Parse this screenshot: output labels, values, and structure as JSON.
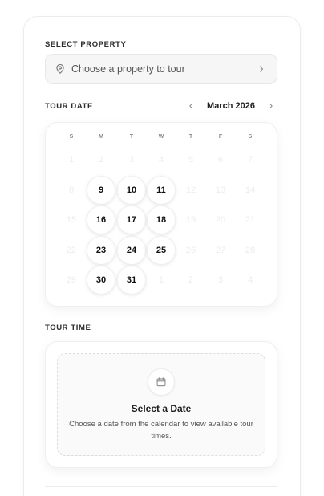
{
  "property": {
    "label": "SELECT PROPERTY",
    "placeholder": "Choose a property to tour",
    "icons": [
      "map-pin-icon",
      "chevron-right-icon"
    ]
  },
  "tour_date": {
    "label": "TOUR DATE",
    "month": "March 2026",
    "weekdays": [
      "S",
      "M",
      "T",
      "W",
      "T",
      "F",
      "S"
    ],
    "weeks": [
      [
        {
          "d": "1",
          "on": false
        },
        {
          "d": "2",
          "on": false
        },
        {
          "d": "3",
          "on": false
        },
        {
          "d": "4",
          "on": false
        },
        {
          "d": "5",
          "on": false
        },
        {
          "d": "6",
          "on": false
        },
        {
          "d": "7",
          "on": false
        }
      ],
      [
        {
          "d": "8",
          "on": false
        },
        {
          "d": "9",
          "on": true
        },
        {
          "d": "10",
          "on": true
        },
        {
          "d": "11",
          "on": true
        },
        {
          "d": "12",
          "on": false
        },
        {
          "d": "13",
          "on": false
        },
        {
          "d": "14",
          "on": false
        }
      ],
      [
        {
          "d": "15",
          "on": false
        },
        {
          "d": "16",
          "on": true
        },
        {
          "d": "17",
          "on": true
        },
        {
          "d": "18",
          "on": true
        },
        {
          "d": "19",
          "on": false
        },
        {
          "d": "20",
          "on": false
        },
        {
          "d": "21",
          "on": false
        }
      ],
      [
        {
          "d": "22",
          "on": false
        },
        {
          "d": "23",
          "on": true
        },
        {
          "d": "24",
          "on": true
        },
        {
          "d": "25",
          "on": true
        },
        {
          "d": "26",
          "on": false
        },
        {
          "d": "27",
          "on": false
        },
        {
          "d": "28",
          "on": false
        }
      ],
      [
        {
          "d": "29",
          "on": false
        },
        {
          "d": "30",
          "on": true
        },
        {
          "d": "31",
          "on": true
        },
        {
          "d": "1",
          "on": false
        },
        {
          "d": "2",
          "on": false
        },
        {
          "d": "3",
          "on": false
        },
        {
          "d": "4",
          "on": false
        }
      ]
    ]
  },
  "tour_time": {
    "label": "TOUR TIME",
    "empty_title": "Select a Date",
    "empty_description": "Choose a date from the calendar to view available tour times.",
    "icon": "calendar-icon"
  }
}
